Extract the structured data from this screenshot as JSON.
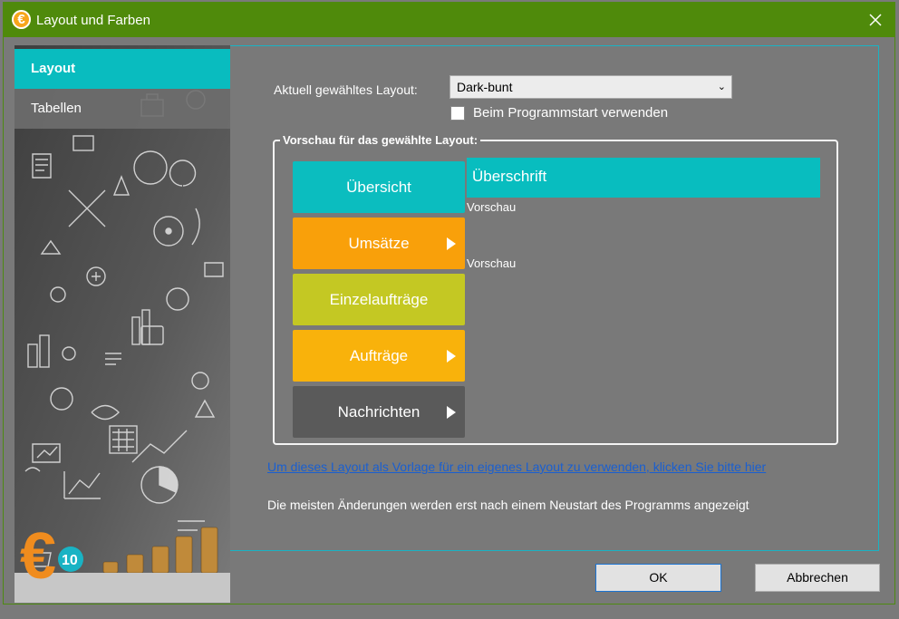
{
  "window": {
    "title": "Layout und Farben",
    "icon": "euro-logo-icon"
  },
  "sidebar": {
    "items": [
      {
        "label": "Layout",
        "active": true
      },
      {
        "label": "Tabellen",
        "active": false
      }
    ],
    "logo": {
      "number": "10"
    }
  },
  "layout_section": {
    "label": "Aktuell gewähltes Layout:",
    "selected": "Dark-bunt",
    "checkbox_label": "Beim Programmstart verwenden",
    "checkbox_checked": false
  },
  "preview": {
    "legend": "Vorschau für das gewählte Layout:",
    "buttons": [
      {
        "label": "Übersicht",
        "color": "#0bbdbf",
        "arrow": false
      },
      {
        "label": "Umsätze",
        "color": "#f9a00a",
        "arrow": true
      },
      {
        "label": "Einzelaufträge",
        "color": "#c4c823",
        "arrow": false
      },
      {
        "label": "Aufträge",
        "color": "#f9b20b",
        "arrow": true
      },
      {
        "label": "Nachrichten",
        "color": "#5a5a5a",
        "arrow": true
      }
    ],
    "heading": "Überschrift",
    "text1": "Vorschau",
    "text2": "Vorschau"
  },
  "link_text": "Um dieses Layout als Vorlage für ein eigenes Layout zu verwenden, klicken Sie bitte hier",
  "note_text": "Die meisten Änderungen werden erst nach einem Neustart des Programms angezeigt",
  "footer": {
    "ok_label": "OK",
    "cancel_label": "Abbrechen"
  },
  "colors": {
    "titlebar": "#4f8a0b",
    "accent": "#09bcbf",
    "background": "#797979"
  }
}
